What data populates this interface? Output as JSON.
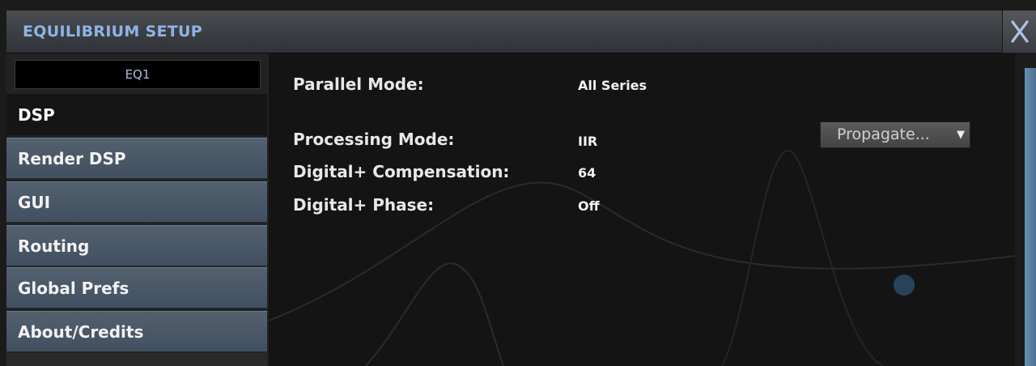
{
  "window": {
    "title": "EQUILIBRIUM SETUP",
    "close_icon": "close-icon"
  },
  "sidebar": {
    "instance_name": "EQ1",
    "items": [
      {
        "label": "DSP",
        "active": true
      },
      {
        "label": "Render DSP",
        "active": false
      },
      {
        "label": "GUI",
        "active": false
      },
      {
        "label": "Routing",
        "active": false
      },
      {
        "label": "Global Prefs",
        "active": false
      },
      {
        "label": "About/Credits",
        "active": false
      }
    ]
  },
  "dsp": {
    "parallel_mode": {
      "label": "Parallel Mode:",
      "value": "All Series"
    },
    "processing_mode": {
      "label": "Processing Mode:",
      "value": "IIR"
    },
    "digital_compensation": {
      "label": "Digital+ Compensation:",
      "value": "64"
    },
    "digital_phase": {
      "label": "Digital+ Phase:",
      "value": "Off"
    },
    "propagate_button": "Propagate...",
    "propagate_icon": "dropdown-arrow-icon"
  },
  "colors": {
    "title": "#8fb4e4",
    "nav_bg": "#4b5968",
    "active_nav_bg": "#151515",
    "accent_blue": "#5b80a6"
  }
}
